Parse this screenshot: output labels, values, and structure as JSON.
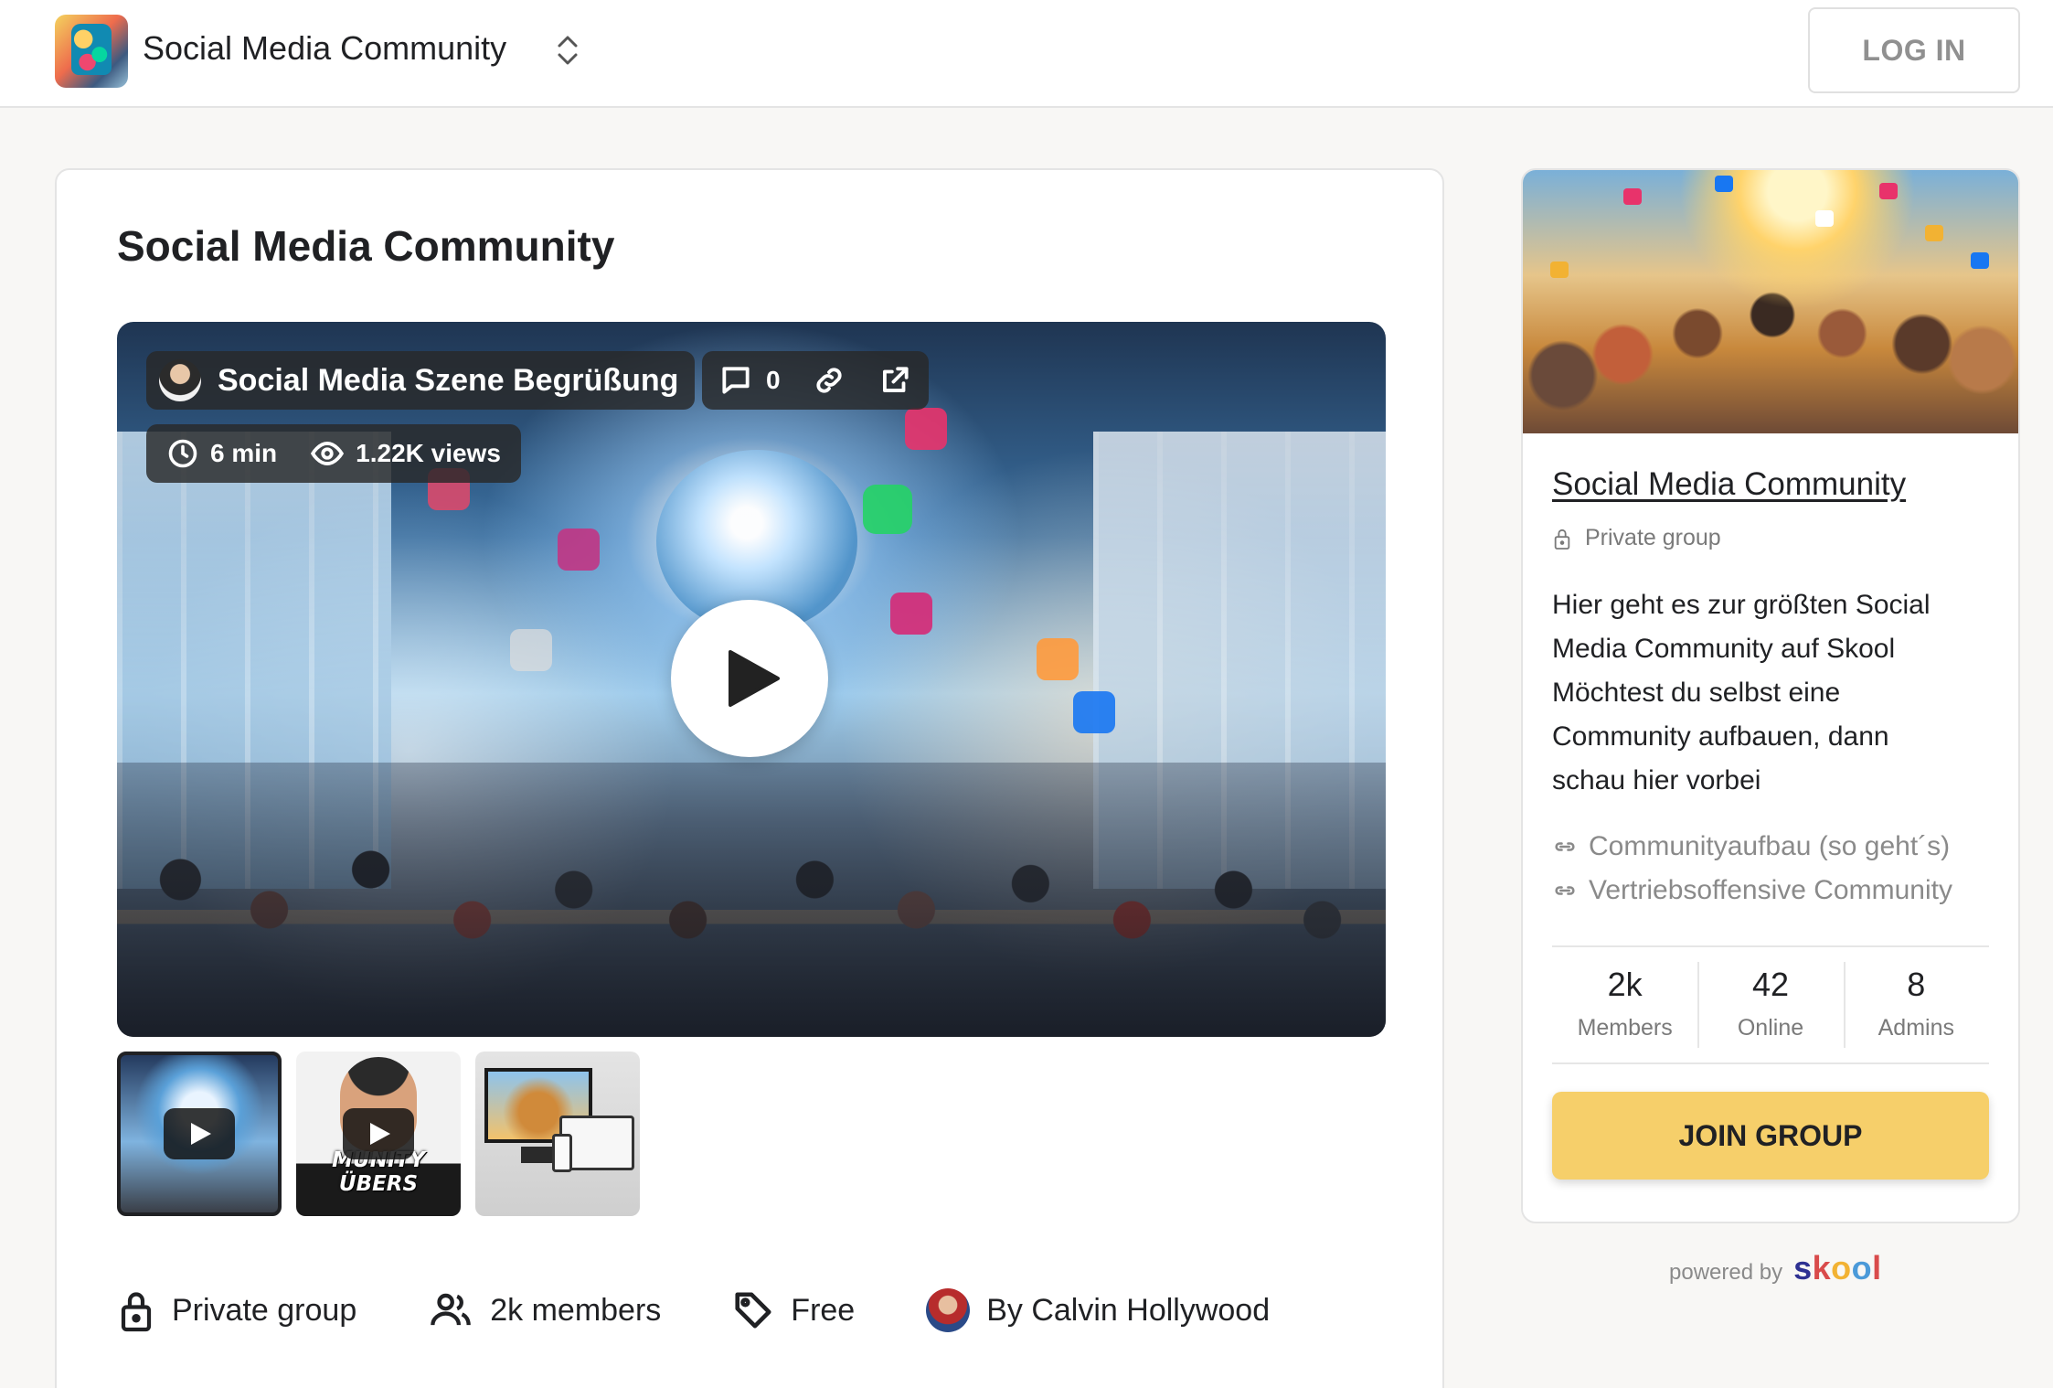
{
  "header": {
    "app_title": "Social Media Community",
    "login_label": "LOG IN"
  },
  "main": {
    "title": "Social Media Community",
    "video": {
      "title": "Social Media Szene Begrüßung",
      "comment_count": "0",
      "duration": "6 min",
      "views": "1.22K views"
    },
    "thumbnails": [
      {
        "caption": ""
      },
      {
        "caption": "MUNITY ÜBERS"
      },
      {
        "caption": ""
      }
    ],
    "meta": {
      "privacy": "Private group",
      "members": "2k members",
      "price": "Free",
      "author": "By Calvin Hollywood"
    }
  },
  "sidebar": {
    "group_name": "Social Media Community",
    "privacy": "Private group",
    "description_lines": [
      "Hier geht es zur größten Social",
      "Media Community auf Skool",
      "Möchtest du selbst eine",
      "Community aufbauen, dann",
      "schau hier vorbei"
    ],
    "links": [
      "Communityaufbau (so geht´s)",
      "Vertriebsoffensive Community"
    ],
    "stats": [
      {
        "value": "2k",
        "label": "Members"
      },
      {
        "value": "42",
        "label": "Online"
      },
      {
        "value": "8",
        "label": "Admins"
      }
    ],
    "join_label": "JOIN GROUP"
  },
  "footer": {
    "powered_by": "powered by",
    "brand_letters": [
      "s",
      "k",
      "o",
      "o",
      "l"
    ]
  },
  "colors": {
    "join_button": "#f6cf6a",
    "background": "#f8f7f5",
    "muted_text": "#7a7a7a"
  }
}
